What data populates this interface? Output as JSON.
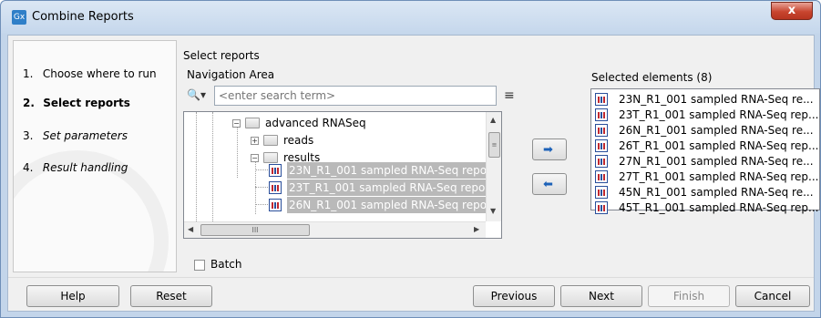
{
  "window": {
    "app_icon": "Gx",
    "title": "Combine Reports",
    "close_label": "x"
  },
  "steps": [
    {
      "num": "1.",
      "label": "Choose where to run"
    },
    {
      "num": "2.",
      "label": "Select reports"
    },
    {
      "num": "3.",
      "label": "Set parameters"
    },
    {
      "num": "4.",
      "label": "Result handling"
    }
  ],
  "main": {
    "section_label": "Select reports",
    "nav_label": "Navigation Area",
    "search": {
      "icon": "search-icon",
      "placeholder": "<enter search term>"
    },
    "tree": [
      {
        "label": "advanced RNASeq",
        "icon": "folder-icon",
        "expander": "-"
      },
      {
        "label": "reads",
        "icon": "folder-icon",
        "expander": "+"
      },
      {
        "label": "results",
        "icon": "folder-icon",
        "expander": "-"
      },
      {
        "label": "23N_R1_001 sampled RNA-Seq repo",
        "icon": "report-icon"
      },
      {
        "label": "23T_R1_001 sampled RNA-Seq repo",
        "icon": "report-icon"
      },
      {
        "label": "26N_R1_001 sampled RNA-Seq repo",
        "icon": "report-icon"
      }
    ],
    "hscroll_thumb": "III",
    "batch_label": "Batch",
    "batch_checked": false
  },
  "selected": {
    "label": "Selected elements (8)",
    "items": [
      "23N_R1_001 sampled RNA-Seq re...",
      "23T_R1_001 sampled RNA-Seq rep...",
      "26N_R1_001 sampled RNA-Seq re...",
      "26T_R1_001 sampled RNA-Seq rep...",
      "27N_R1_001 sampled RNA-Seq re...",
      "27T_R1_001 sampled RNA-Seq rep...",
      "45N_R1_001 sampled RNA-Seq re...",
      "45T_R1_001 sampled RNA-Seq rep..."
    ]
  },
  "buttons": {
    "help": "Help",
    "reset": "Reset",
    "previous": "Previous",
    "next": "Next",
    "finish": "Finish",
    "cancel": "Cancel"
  },
  "colors": {
    "accent": "#1d62b8",
    "close_red": "#c8452f",
    "frame": "#c3d5ea"
  }
}
